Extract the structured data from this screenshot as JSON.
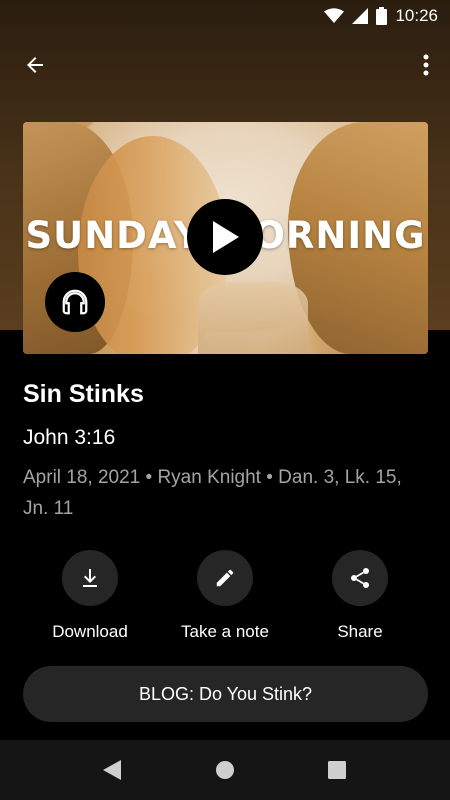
{
  "status_bar": {
    "time": "10:26",
    "icons": [
      "wifi-icon",
      "signal-icon",
      "battery-icon"
    ]
  },
  "app_bar": {
    "back_icon": "arrow-back-icon",
    "menu_icon": "more-vert-icon"
  },
  "media": {
    "thumbnail_text": "SUNDAY MORNING",
    "play_icon": "play-icon",
    "audio_icon": "headphones-icon"
  },
  "sermon": {
    "title": "Sin Stinks",
    "scripture": "John 3:16",
    "meta": "April 18, 2021 • Ryan Knight • Dan. 3, Lk. 15, Jn. 11"
  },
  "actions": [
    {
      "label": "Download",
      "icon": "download-icon"
    },
    {
      "label": "Take a note",
      "icon": "pencil-icon"
    },
    {
      "label": "Share",
      "icon": "share-icon"
    }
  ],
  "blog_button": {
    "label": "BLOG: Do You Stink?"
  },
  "nav_bar": {
    "icons": [
      "nav-back-icon",
      "nav-home-icon",
      "nav-recents-icon"
    ]
  },
  "colors": {
    "background": "#000000",
    "button_surface": "#262626",
    "meta_text": "#a4a4a4",
    "hero_gradient_top": "#2a1d0f",
    "hero_gradient_bottom": "#5a3e1f"
  }
}
